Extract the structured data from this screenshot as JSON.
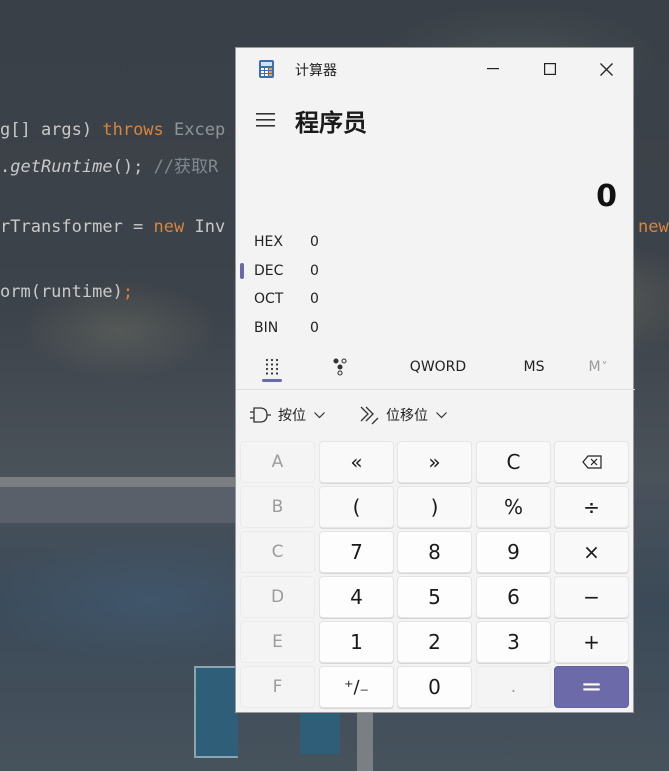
{
  "background_code": {
    "line1": {
      "a": "g[] args) ",
      "b": "throws",
      "c": " Excep"
    },
    "line2": {
      "a": ".",
      "b": "getRuntime",
      "c": "(); ",
      "d": "//获取R"
    },
    "line3": {
      "a": "rTransformer = ",
      "b": "new",
      "c": " Inv",
      "d": "new"
    },
    "line4": {
      "a": "orm(runtime)",
      "b": ";"
    }
  },
  "window": {
    "title": "计算器",
    "minimize_glyph": "—",
    "maximize_glyph": "☐",
    "close_glyph": "✕"
  },
  "header": {
    "mode_title": "程序员"
  },
  "display": {
    "value": "0"
  },
  "radix": [
    {
      "label": "HEX",
      "value": "0"
    },
    {
      "label": "DEC",
      "value": "0"
    },
    {
      "label": "OCT",
      "value": "0"
    },
    {
      "label": "BIN",
      "value": "0"
    }
  ],
  "tabs": {
    "word_size": "QWORD",
    "memory_store": "MS",
    "memory_recall": "M",
    "memory_chevron": "˅"
  },
  "bitops": {
    "bitwise_label": "按位",
    "bitshift_label": "位移位"
  },
  "keys": {
    "row1": [
      "A",
      "«",
      "»",
      "C",
      "⌫"
    ],
    "row2": [
      "B",
      "(",
      ")",
      "%",
      "÷"
    ],
    "row3": [
      "C",
      "7",
      "8",
      "9",
      "×"
    ],
    "row4": [
      "D",
      "4",
      "5",
      "6",
      "−"
    ],
    "row5": [
      "E",
      "1",
      "2",
      "3",
      "+"
    ],
    "row6": [
      "F",
      "⁺∕₋",
      "0",
      ".",
      "="
    ]
  },
  "colors": {
    "accent": "#6d6aa9",
    "keyword": "#d8843c"
  }
}
